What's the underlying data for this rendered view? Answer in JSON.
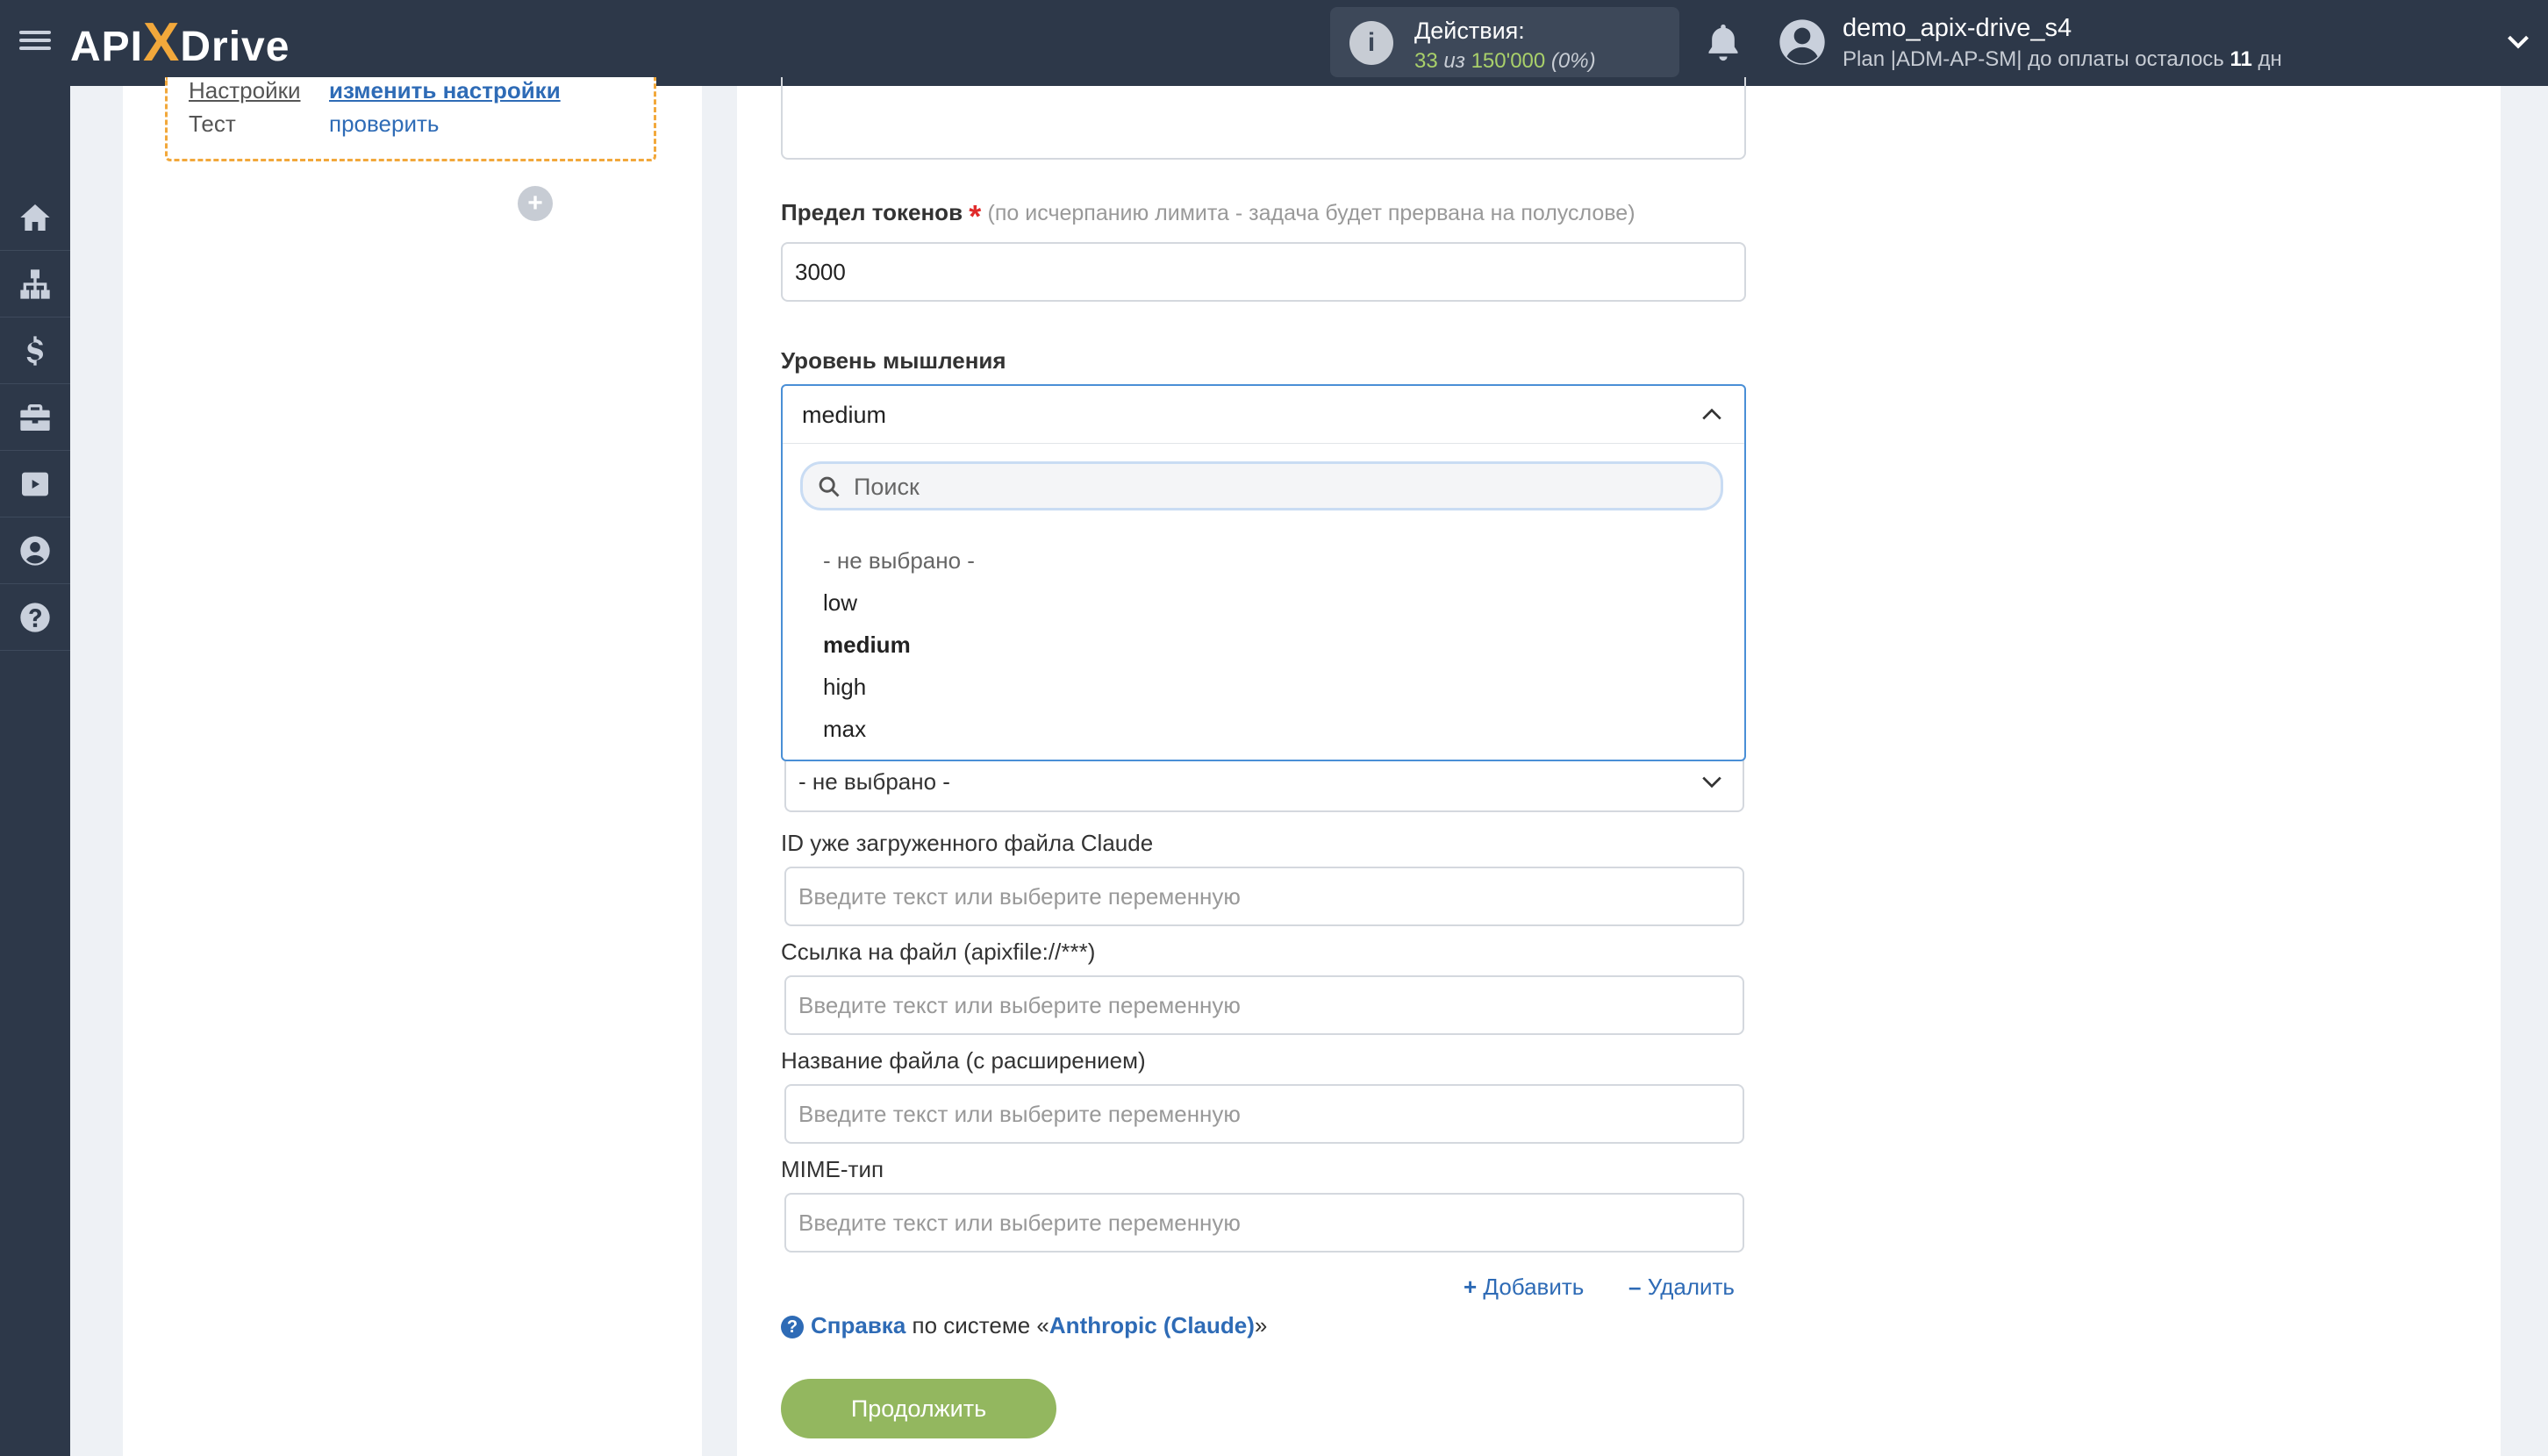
{
  "header": {
    "logo": {
      "left": "API",
      "x": "X",
      "right": "Drive"
    },
    "actions": {
      "label": "Действия:",
      "used": "33",
      "of_word": "из",
      "limit": "150'000",
      "percent": "(0%)"
    },
    "user": {
      "name": "demo_apix-drive_s4",
      "plan_text": "Plan |ADM-AP-SM| до оплаты осталось",
      "days": "11",
      "days_unit": "дн"
    }
  },
  "sidebar": {
    "items": [
      {
        "icon": "home-icon"
      },
      {
        "icon": "sitemap-icon"
      },
      {
        "icon": "dollar-icon"
      },
      {
        "icon": "briefcase-icon"
      },
      {
        "icon": "youtube-icon"
      },
      {
        "icon": "user-circle-icon"
      },
      {
        "icon": "help-icon"
      }
    ]
  },
  "left_panel": {
    "rows": [
      {
        "key": "Настройки",
        "value": "изменить настройки"
      },
      {
        "key": "Тест",
        "value": "проверить"
      }
    ],
    "add_symbol": "+"
  },
  "form": {
    "token_limit": {
      "label": "Предел токенов",
      "required_mark": "*",
      "hint": "(по исчерпанию лимита - задача будет прервана на полуслове)",
      "value": "3000"
    },
    "thinking_level": {
      "label": "Уровень мышления",
      "selected": "medium",
      "search_placeholder": "Поиск",
      "options": [
        "- не выбрано -",
        "low",
        "medium",
        "high",
        "max"
      ]
    },
    "next_select_value": "- не выбрано -",
    "file_id": {
      "label": "ID уже загруженного файла Claude",
      "placeholder": "Введите текст или выберите переменную"
    },
    "file_link": {
      "label": "Ссылка на файл (apixfile://***)",
      "placeholder": "Введите текст или выберите переменную"
    },
    "file_name": {
      "label": "Название файла (с расширением)",
      "placeholder": "Введите текст или выберите переменную"
    },
    "mime_type": {
      "label": "MIME-тип",
      "placeholder": "Введите текст или выберите переменную"
    },
    "add_label": "Добавить",
    "remove_label": "Удалить",
    "help": {
      "prefix": "Справка",
      "middle": "по системе «",
      "system": "Anthropic (Claude)",
      "suffix": "»"
    },
    "continue_label": "Продолжить"
  },
  "colors": {
    "header_bg": "#2d3849",
    "accent_orange": "#f2a83b",
    "link_blue": "#2e6bb6",
    "continue_green": "#93b75f",
    "actions_green": "#a9d06a"
  }
}
